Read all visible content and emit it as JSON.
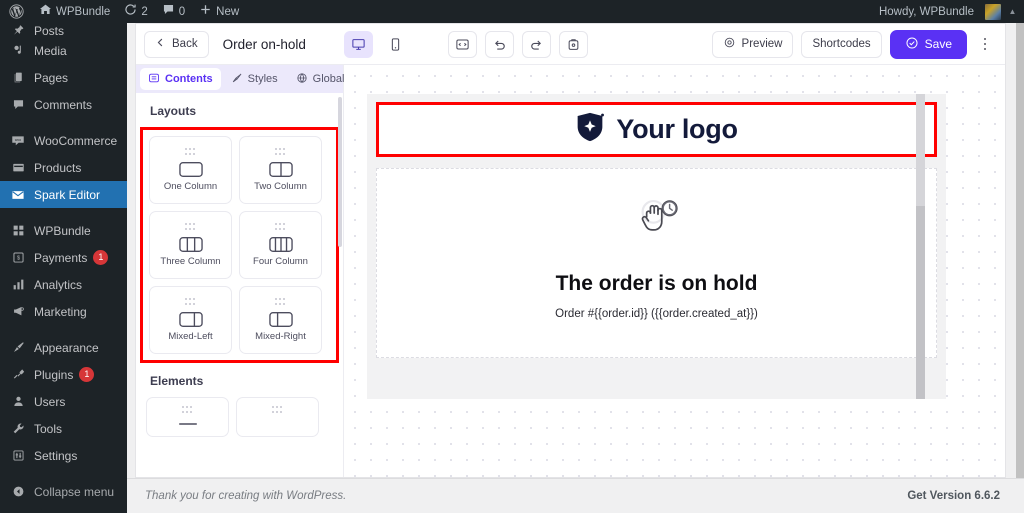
{
  "adminbar": {
    "logo_icon": "wordpress-logo-icon",
    "site": {
      "icon": "home-icon",
      "label": "WPBundle"
    },
    "updates": {
      "icon": "updates-icon",
      "count": "2"
    },
    "comments": {
      "icon": "comment-icon",
      "count": "0"
    },
    "new": {
      "icon": "plus-icon",
      "label": "New"
    },
    "howdy": "Howdy, WPBundle"
  },
  "sidebar": {
    "items": [
      {
        "label": "Posts",
        "icon": "pin-icon",
        "badge": null,
        "active": false,
        "clipped": true
      },
      {
        "label": "Media",
        "icon": "media-icon",
        "badge": null,
        "active": false
      },
      {
        "label": "Pages",
        "icon": "pages-icon",
        "badge": null,
        "active": false
      },
      {
        "label": "Comments",
        "icon": "comment-icon",
        "badge": null,
        "active": false
      },
      {
        "label": "WooCommerce",
        "icon": "woocommerce-icon",
        "badge": null,
        "active": false,
        "sep_before": true
      },
      {
        "label": "Products",
        "icon": "products-icon",
        "badge": null,
        "active": false
      },
      {
        "label": "Spark Editor",
        "icon": "envelope-icon",
        "badge": null,
        "active": true
      },
      {
        "label": "WPBundle",
        "icon": "grid-icon",
        "badge": null,
        "active": false,
        "sep_before": true
      },
      {
        "label": "Payments",
        "icon": "payments-icon",
        "badge": "1",
        "active": false
      },
      {
        "label": "Analytics",
        "icon": "chart-bars-icon",
        "badge": null,
        "active": false
      },
      {
        "label": "Marketing",
        "icon": "megaphone-icon",
        "badge": null,
        "active": false
      },
      {
        "label": "Appearance",
        "icon": "paintbrush-icon",
        "badge": null,
        "active": false,
        "sep_before": true
      },
      {
        "label": "Plugins",
        "icon": "plug-icon",
        "badge": "1",
        "active": false
      },
      {
        "label": "Users",
        "icon": "user-icon",
        "badge": null,
        "active": false
      },
      {
        "label": "Tools",
        "icon": "wrench-icon",
        "badge": null,
        "active": false
      },
      {
        "label": "Settings",
        "icon": "sliders-icon",
        "badge": null,
        "active": false
      }
    ],
    "collapse": {
      "label": "Collapse menu",
      "icon": "collapse-arrow-icon"
    }
  },
  "toolbar": {
    "back_label": "Back",
    "back_icon": "chevron-left-icon",
    "title": "Order on-hold",
    "devices": [
      {
        "name": "desktop-icon",
        "active": true
      },
      {
        "name": "mobile-icon",
        "active": false
      }
    ],
    "actions": [
      {
        "name": "code-view-icon"
      },
      {
        "name": "undo-icon"
      },
      {
        "name": "redo-icon"
      },
      {
        "name": "revisions-icon"
      }
    ],
    "preview_label": "Preview",
    "preview_icon": "eye-icon",
    "shortcodes_label": "Shortcodes",
    "save_label": "Save",
    "save_icon": "check-circle-icon",
    "save_color": "#5a31f4",
    "more_icon": "kebab-menu-icon"
  },
  "panel": {
    "tabs": [
      {
        "label": "Contents",
        "icon": "contents-icon",
        "active": true
      },
      {
        "label": "Styles",
        "icon": "brush-icon",
        "active": false
      },
      {
        "label": "Global",
        "icon": "globe-icon",
        "active": false
      }
    ],
    "layouts_title": "Layouts",
    "layouts": [
      {
        "label": "One Column",
        "icon": "one-column-icon"
      },
      {
        "label": "Two Column",
        "icon": "two-column-icon"
      },
      {
        "label": "Three Column",
        "icon": "three-column-icon"
      },
      {
        "label": "Four Column",
        "icon": "four-column-icon"
      },
      {
        "label": "Mixed-Left",
        "icon": "mixed-left-icon"
      },
      {
        "label": "Mixed-Right",
        "icon": "mixed-right-icon"
      }
    ],
    "elements_title": "Elements",
    "highlight_color": "#ff0000"
  },
  "canvas": {
    "logo_text": "Your logo",
    "logo_icon": "shield-sparkle-logo-icon",
    "logo_color": "#131a3a",
    "hold_icon": "hand-clock-on-hold-icon",
    "heading": "The order is on hold",
    "subtext": "Order #{{order.id}} ({{order.created_at}})"
  },
  "footer": {
    "left": "Thank you for creating with WordPress.",
    "right": "Get Version 6.6.2"
  }
}
